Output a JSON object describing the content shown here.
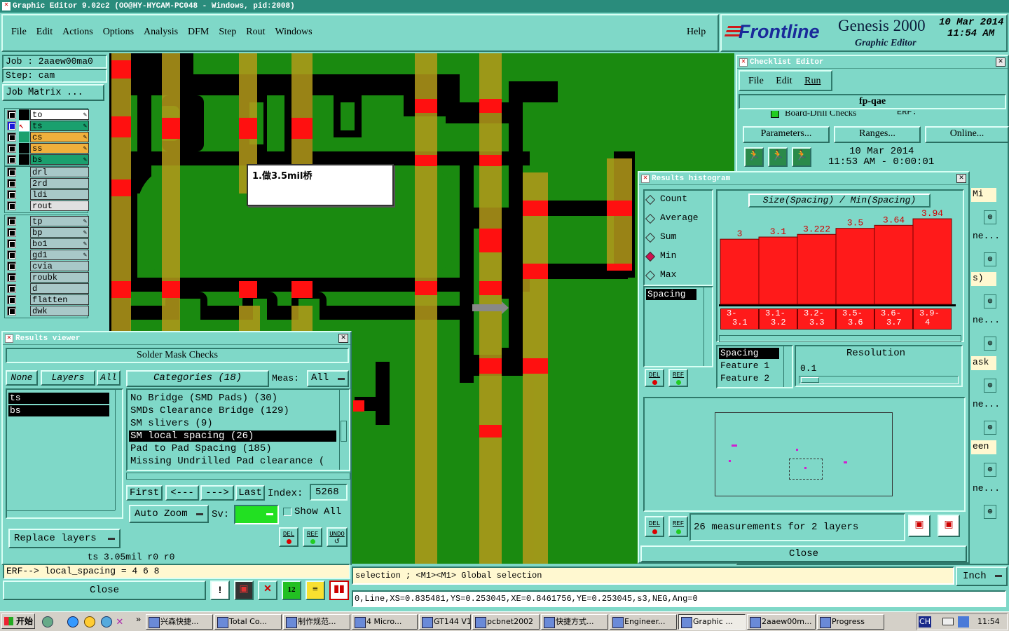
{
  "window": {
    "title": "Graphic Editor 9.02c2 (OO@HY-HYCAM-PC048 - Windows, pid:2008)"
  },
  "menu": {
    "items": [
      "File",
      "Edit",
      "Actions",
      "Options",
      "Analysis",
      "DFM",
      "Step",
      "Rout",
      "Windows"
    ],
    "help": "Help"
  },
  "brand": {
    "logo": "Frontline",
    "product": "Genesis 2000",
    "subtitle": "Graphic Editor",
    "date": "10 Mar 2014",
    "time": "11:54 AM"
  },
  "job": {
    "job_label": "Job : 2aaew00ma0",
    "step_label": "Step: cam",
    "matrix_button": "Job Matrix ..."
  },
  "layers": {
    "group1": [
      {
        "name": "to",
        "color": "#ffffff"
      },
      {
        "name": "ts",
        "color": "#1aa06e"
      },
      {
        "name": "cs",
        "color": "#f0b03c"
      },
      {
        "name": "ss",
        "color": "#f0b03c"
      },
      {
        "name": "bs",
        "color": "#1aa06e"
      }
    ],
    "group2": [
      {
        "name": "drl",
        "color": "#a8c8c8"
      },
      {
        "name": "2rd",
        "color": "#a8c8c8"
      },
      {
        "name": "ldi",
        "color": "#a8c8c8"
      },
      {
        "name": "rout",
        "color": "#e0e0e0"
      }
    ],
    "group3": [
      {
        "name": "tp",
        "color": "#a8c8c8"
      },
      {
        "name": "bp",
        "color": "#a8c8c8"
      },
      {
        "name": "bo1",
        "color": "#a8c8c8"
      },
      {
        "name": "gd1",
        "color": "#a8c8c8"
      },
      {
        "name": "cvia",
        "color": "#a8c8c8"
      },
      {
        "name": "roubk",
        "color": "#a8c8c8"
      },
      {
        "name": "d",
        "color": "#a8c8c8"
      },
      {
        "name": "flatten",
        "color": "#a8c8c8"
      },
      {
        "name": "dwk",
        "color": "#a8c8c8"
      }
    ]
  },
  "canvas": {
    "annotation": "1.做3.5mil桥"
  },
  "results_viewer": {
    "title": "Results viewer",
    "header": "Solder Mask Checks",
    "none_btn": "None",
    "layers_btn": "Layers",
    "all_btn": "All",
    "categories_label": "Categories (18)",
    "meas_label": "Meas:",
    "meas_value": "All",
    "layer_list": [
      "ts",
      "bs"
    ],
    "categories": [
      "No Bridge (SMD Pads) (30)",
      "SMDs Clearance Bridge (129)",
      "SM slivers (9)",
      "SM local spacing (26)",
      "Pad to Pad Spacing (185)",
      "Missing Undrilled Pad clearance ("
    ],
    "selected_category": 3,
    "first": "First",
    "prev": "<---",
    "next": "--->",
    "last": "Last",
    "index_label": "Index:",
    "index_value": "5268",
    "auto_zoom": "Auto Zoom",
    "sv_label": "Sv:",
    "show_all": "Show All",
    "replace_layers": "Replace layers",
    "status": "ts 3.05mil  r0  r0",
    "close": "Close",
    "del": "DEL",
    "ref": "REF",
    "undo": "UNDO"
  },
  "erf_line": "ERF--> local_spacing = 4 6 8",
  "status_bar": {
    "selection": "selection ; <M1><M1> Global selection",
    "coords": "0,Line,XS=0.835481,YS=0.253045,XE=0.8461756,YE=0.253045,s3,NEG,Ang=0",
    "units": "Inch"
  },
  "checklist": {
    "title": "Checklist Editor",
    "menu": [
      "File",
      "Edit",
      "Run"
    ],
    "name": "fp-qae",
    "row": "Board-Drill Checks",
    "erf": "ERF:",
    "buttons": [
      "Parameters...",
      "Ranges...",
      "Online..."
    ],
    "date": "10 Mar 2014",
    "time": "11:53 AM - 0:00:01",
    "side_labels": [
      "Mi",
      "ne...",
      "s)",
      "ne...",
      "ask",
      "ne...",
      "een",
      "ne..."
    ]
  },
  "histogram": {
    "title": "Results histogram",
    "modes": [
      "Count",
      "Average",
      "Sum",
      "Min",
      "Max"
    ],
    "selected_mode": "Min",
    "heading": "Size(Spacing) / Min(Spacing)",
    "list_item": "Spacing",
    "attrs": [
      "Spacing",
      "Feature 1",
      "Feature 2"
    ],
    "resolution_label": "Resolution",
    "resolution_value": "0.1",
    "measurements": "26 measurements for 2 layers",
    "close": "Close",
    "del": "DEL",
    "ref": "REF"
  },
  "chart_data": {
    "type": "bar",
    "title": "Size(Spacing) / Min(Spacing)",
    "categories": [
      "3-3.1",
      "3.1-3.2",
      "3.2-3.3",
      "3.5-3.6",
      "3.6-3.7",
      "3.9-4"
    ],
    "bin_lines": [
      [
        "3-",
        "3.1"
      ],
      [
        "3.1-",
        "3.2"
      ],
      [
        "3.2-",
        "3.3"
      ],
      [
        "3.5-",
        "3.6"
      ],
      [
        "3.6-",
        "3.7"
      ],
      [
        "3.9-",
        "4"
      ]
    ],
    "values": [
      3,
      3.1,
      3.222,
      3.5,
      3.64,
      3.94
    ],
    "labels": [
      "3",
      "3.1",
      "3.222",
      "3.5",
      "3.64",
      "3.94"
    ],
    "ylim": [
      0,
      4.2
    ],
    "bar_color": "#ff1a1a"
  },
  "taskbar": {
    "start": "开始",
    "items": [
      "兴森快捷...",
      "Total Co...",
      "制作规范...",
      "4 Micro...",
      "GT144 V1...",
      "pcbnet2002",
      "快捷方式...",
      "Engineer...",
      "Graphic ...",
      "2aaew00m...",
      "Progress"
    ],
    "lang": "CH",
    "clock": "11:54"
  }
}
